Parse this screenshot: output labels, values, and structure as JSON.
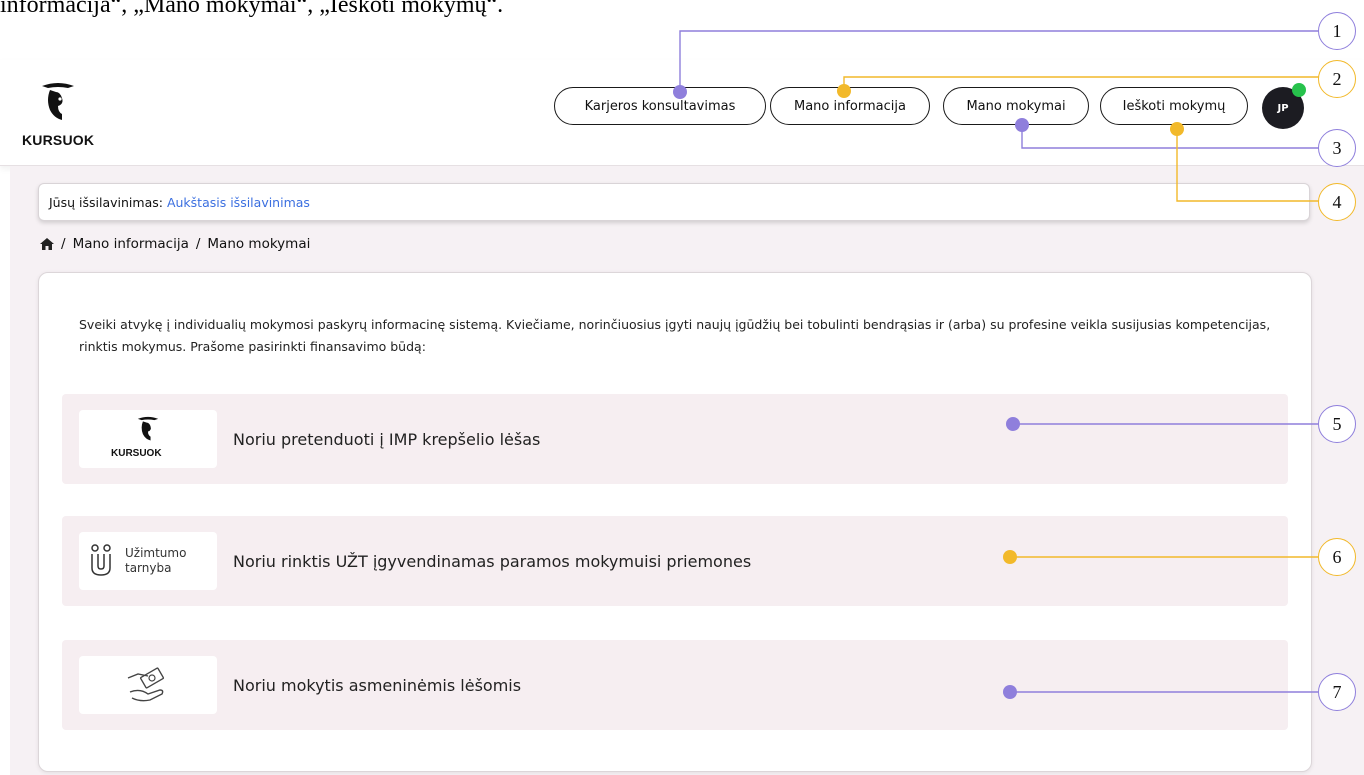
{
  "caption": "informacija“, „Mano mokymai“, „Ieškoti mokymų“.",
  "header": {
    "logo_text": "KURSUOK",
    "nav": [
      {
        "label": "Karjeros konsultavimas"
      },
      {
        "label": "Mano informacija"
      },
      {
        "label": "Mano mokymai"
      },
      {
        "label": "Ieškoti mokymų"
      }
    ],
    "avatar_initials": "JP",
    "avatar_status_color": "#27c24c"
  },
  "education": {
    "label": "Jūsų išsilavinimas:",
    "value": "Aukštasis išsilavinimas"
  },
  "breadcrumb": {
    "home_icon": "home-icon",
    "items": [
      "Mano informacija",
      "Mano mokymai"
    ],
    "separator": "/"
  },
  "intro_text": "Sveiki atvykę į individualių mokymosi paskyrų informacinę sistemą. Kviečiame, norinčiuosius įgyti naujų įgūdžių bei tobulinti bendrąsias ir (arba) su profesine veikla susijusias kompetencijas, rinktis mokymus. Prašome pasirinkti finansavimo būdą:",
  "options": [
    {
      "label": "Noriu pretenduoti į IMP krepšelio lėšas",
      "logo_text": "KURSUOK",
      "icon": "kursuok-logo-icon"
    },
    {
      "label": "Noriu rinktis UŽT įgyvendinamas paramos mokymuisi priemones",
      "logo_text_1": "Užimtumo",
      "logo_text_2": "tarnyba",
      "icon": "uzt-logo-icon"
    },
    {
      "label": "Noriu mokytis asmeninėmis lėšomis",
      "icon": "money-hand-icon"
    }
  ],
  "annotations": {
    "labels": [
      "1",
      "2",
      "3",
      "4",
      "5",
      "6",
      "7"
    ],
    "colors": {
      "purple": "#8f7fdc",
      "yellow": "#f2b92a"
    }
  },
  "colors": {
    "page_bg": "#f6f1f4",
    "option_bg": "#f6eef1",
    "link": "#3b6fe0",
    "avatar_bg": "#1c1c22"
  }
}
